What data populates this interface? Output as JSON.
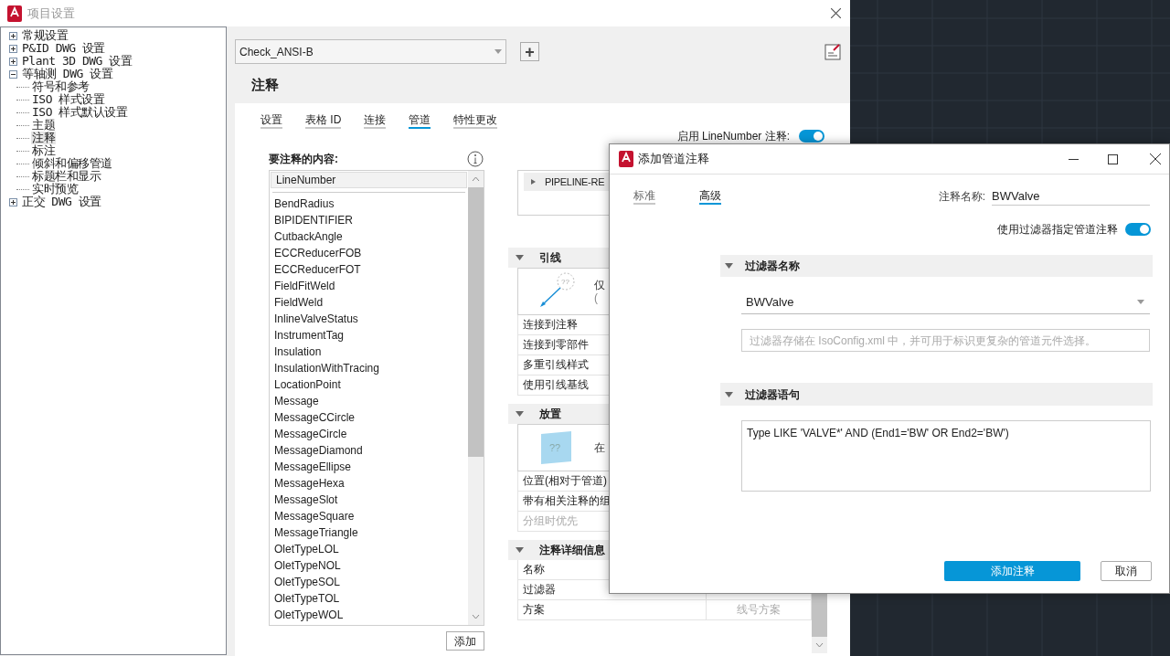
{
  "window": {
    "title": "项目设置"
  },
  "tree": [
    {
      "label": "常规设置",
      "expanded": false,
      "selected": false
    },
    {
      "label": "P&ID DWG 设置",
      "expanded": false,
      "selected": false
    },
    {
      "label": "Plant 3D DWG 设置",
      "expanded": false,
      "selected": false
    },
    {
      "label": "等轴测 DWG 设置",
      "expanded": true,
      "selected": false,
      "children": [
        {
          "label": "符号和参考",
          "selected": false
        },
        {
          "label": "ISO 样式设置",
          "selected": false
        },
        {
          "label": "ISO 样式默认设置",
          "selected": false
        },
        {
          "label": "主题",
          "selected": false
        },
        {
          "label": "注释",
          "selected": true
        },
        {
          "label": "标注",
          "selected": false
        },
        {
          "label": "倾斜和偏移管道",
          "selected": false
        },
        {
          "label": "标题栏和显示",
          "selected": false
        },
        {
          "label": "实时预览",
          "selected": false
        }
      ]
    },
    {
      "label": "正交 DWG 设置",
      "expanded": false,
      "selected": false
    }
  ],
  "style_dropdown": {
    "value": "Check_ANSI-B"
  },
  "add_style_button": "+",
  "heading": "注释",
  "tabs": [
    {
      "label": "设置",
      "selected": false
    },
    {
      "label": "表格 ID",
      "selected": false
    },
    {
      "label": "连接",
      "selected": false
    },
    {
      "label": "管道",
      "selected": true
    },
    {
      "label": "特性更改",
      "selected": false
    }
  ],
  "enable_toggle": {
    "label": "启用 LineNumber 注释:",
    "on": true
  },
  "content_list": {
    "label": "要注释的内容:",
    "items": [
      {
        "label": "LineNumber",
        "selected": true
      },
      {
        "label": "BendRadius",
        "selected": false
      },
      {
        "label": "BIPIDENTIFIER",
        "selected": false
      },
      {
        "label": "CutbackAngle",
        "selected": false
      },
      {
        "label": "ECCReducerFOB",
        "selected": false
      },
      {
        "label": "ECCReducerFOT",
        "selected": false
      },
      {
        "label": "FieldFitWeld",
        "selected": false
      },
      {
        "label": "FieldWeld",
        "selected": false
      },
      {
        "label": "InlineValveStatus",
        "selected": false
      },
      {
        "label": "InstrumentTag",
        "selected": false
      },
      {
        "label": "Insulation",
        "selected": false
      },
      {
        "label": "InsulationWithTracing",
        "selected": false
      },
      {
        "label": "LocationPoint",
        "selected": false
      },
      {
        "label": "Message",
        "selected": false
      },
      {
        "label": "MessageCCircle",
        "selected": false
      },
      {
        "label": "MessageCircle",
        "selected": false
      },
      {
        "label": "MessageDiamond",
        "selected": false
      },
      {
        "label": "MessageEllipse",
        "selected": false
      },
      {
        "label": "MessageHexa",
        "selected": false
      },
      {
        "label": "MessageSlot",
        "selected": false
      },
      {
        "label": "MessageSquare",
        "selected": false
      },
      {
        "label": "MessageTriangle",
        "selected": false
      },
      {
        "label": "OletTypeLOL",
        "selected": false
      },
      {
        "label": "OletTypeNOL",
        "selected": false
      },
      {
        "label": "OletTypeSOL",
        "selected": false
      },
      {
        "label": "OletTypeTOL",
        "selected": false
      },
      {
        "label": "OletTypeWOL",
        "selected": false
      }
    ],
    "add_button": "添加"
  },
  "annotation_tree": {
    "row": "PIPELINE-RE"
  },
  "sections": [
    {
      "title": "引线",
      "expanded": true,
      "preview": {
        "kind": "leader",
        "mark": "??",
        "lines": [
          "仅",
          "("
        ]
      },
      "rows": [
        {
          "label": "连接到注释",
          "disabled": false
        },
        {
          "label": "连接到零部件",
          "disabled": false
        },
        {
          "label": "多重引线样式",
          "disabled": false
        },
        {
          "label": "使用引线基线",
          "disabled": false
        }
      ]
    },
    {
      "title": "放置",
      "expanded": true,
      "preview": {
        "kind": "placement",
        "mark": "??",
        "lines": [
          "在"
        ]
      },
      "rows": [
        {
          "label": "位置(相对于管道)",
          "disabled": false
        },
        {
          "label": "带有相关注释的组",
          "disabled": false
        },
        {
          "label": "分组时优先",
          "disabled": true
        }
      ]
    },
    {
      "title": "注释详细信息",
      "expanded": true,
      "rows": [
        {
          "label": "名称",
          "disabled": false
        },
        {
          "label": "过滤器",
          "disabled": false
        },
        {
          "label": "方案",
          "disabled": false,
          "value": "线号方案"
        }
      ]
    }
  ],
  "dialog": {
    "title": "添加管道注释",
    "tabs": [
      {
        "label": "标准",
        "selected": false
      },
      {
        "label": "高级",
        "selected": true
      }
    ],
    "name_field": {
      "label": "注释名称:",
      "value": "BWValve"
    },
    "filter_toggle": {
      "label": "使用过滤器指定管道注释",
      "on": true
    },
    "filter_name": {
      "title": "过滤器名称",
      "expanded": true,
      "value": "BWValve",
      "hint": "过滤器存储在 IsoConfig.xml 中，并可用于标识更复杂的管道元件选择。"
    },
    "filter_statement": {
      "title": "过滤器语句",
      "expanded": true,
      "value": "Type LIKE 'VALVE*' AND (End1='BW' OR End2='BW')"
    },
    "buttons": [
      {
        "label": "添加注释",
        "kind": "primary"
      },
      {
        "label": "取消",
        "kind": "secondary"
      }
    ]
  }
}
